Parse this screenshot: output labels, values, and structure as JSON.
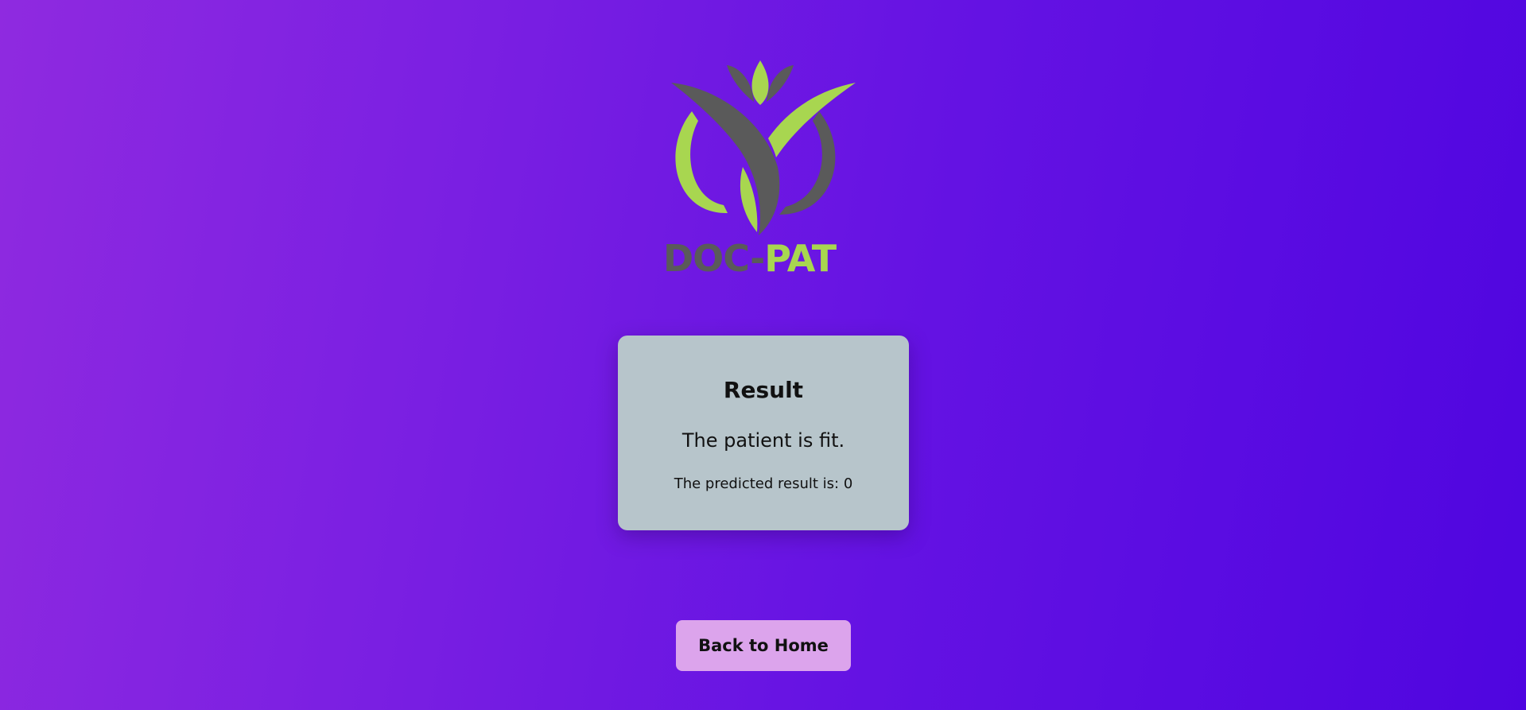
{
  "logo": {
    "text_left": "DOC-",
    "text_right": "PAT",
    "colors": {
      "green": "#a8d650",
      "gray": "#5a5a5a"
    }
  },
  "result": {
    "title": "Result",
    "message": "The patient is fit.",
    "predicted_text": "The predicted result is: 0"
  },
  "actions": {
    "back_label": "Back to Home"
  },
  "colors": {
    "background_start": "#8f2ae0",
    "background_end": "#4f05e0",
    "card": "#b7c5cb",
    "button": "#dca4ec"
  }
}
